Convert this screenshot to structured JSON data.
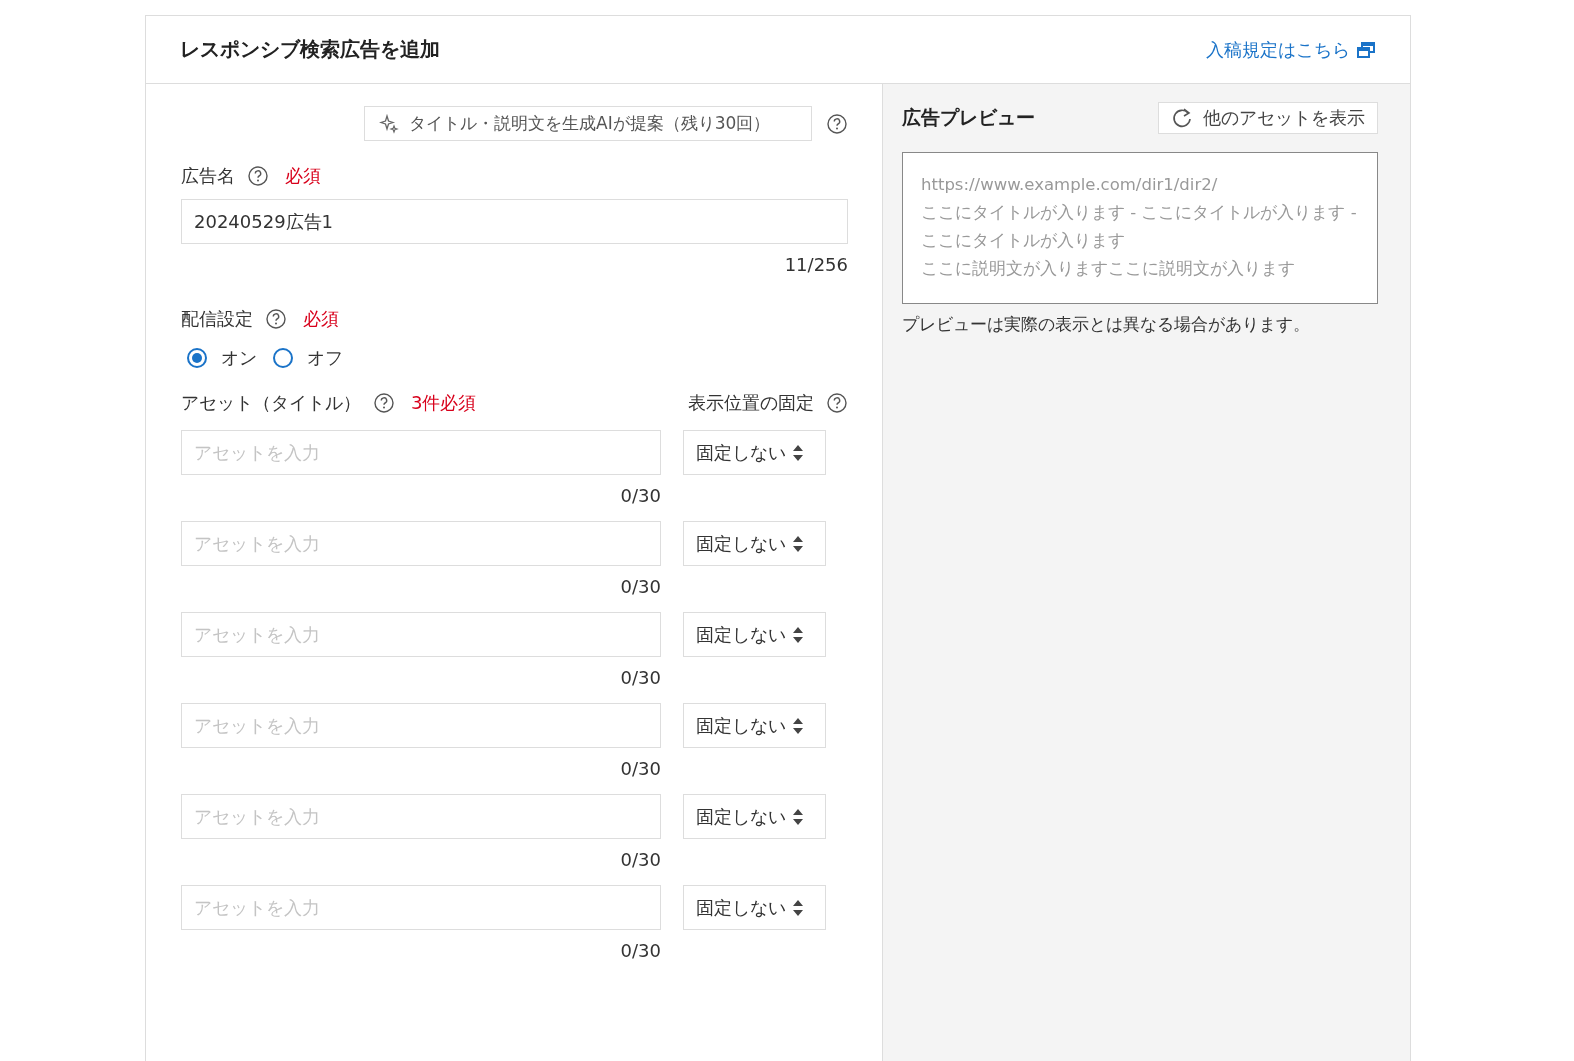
{
  "header": {
    "title": "レスポンシブ検索広告を追加",
    "guideline_link": "入稿規定はこちら"
  },
  "ai_suggest_button": {
    "label": "タイトル・説明文を生成AIが提案（残り30回）"
  },
  "ad_name": {
    "label": "広告名",
    "required": "必須",
    "value": "20240529広告1",
    "counter": "11/256"
  },
  "delivery": {
    "label": "配信設定",
    "required": "必須",
    "options": [
      {
        "label": "オン",
        "selected": true
      },
      {
        "label": "オフ",
        "selected": false
      }
    ]
  },
  "assets": {
    "label": "アセット（タイトル）",
    "required": "3件必須",
    "pin_label": "表示位置の固定",
    "rows": [
      {
        "placeholder": "アセットを入力",
        "counter": "0/30",
        "pin": "固定しない"
      },
      {
        "placeholder": "アセットを入力",
        "counter": "0/30",
        "pin": "固定しない"
      },
      {
        "placeholder": "アセットを入力",
        "counter": "0/30",
        "pin": "固定しない"
      },
      {
        "placeholder": "アセットを入力",
        "counter": "0/30",
        "pin": "固定しない"
      },
      {
        "placeholder": "アセットを入力",
        "counter": "0/30",
        "pin": "固定しない"
      },
      {
        "placeholder": "アセットを入力",
        "counter": "0/30",
        "pin": "固定しない"
      }
    ]
  },
  "preview": {
    "title": "広告プレビュー",
    "refresh_button": "他のアセットを表示",
    "url": "https://www.example.com/dir1/dir2/",
    "ad_title": "ここにタイトルが入ります - ここにタイトルが入ります - ここにタイトルが入ります",
    "description": "ここに説明文が入りますここに説明文が入ります",
    "note": "プレビューは実際の表示とは異なる場合があります。"
  }
}
